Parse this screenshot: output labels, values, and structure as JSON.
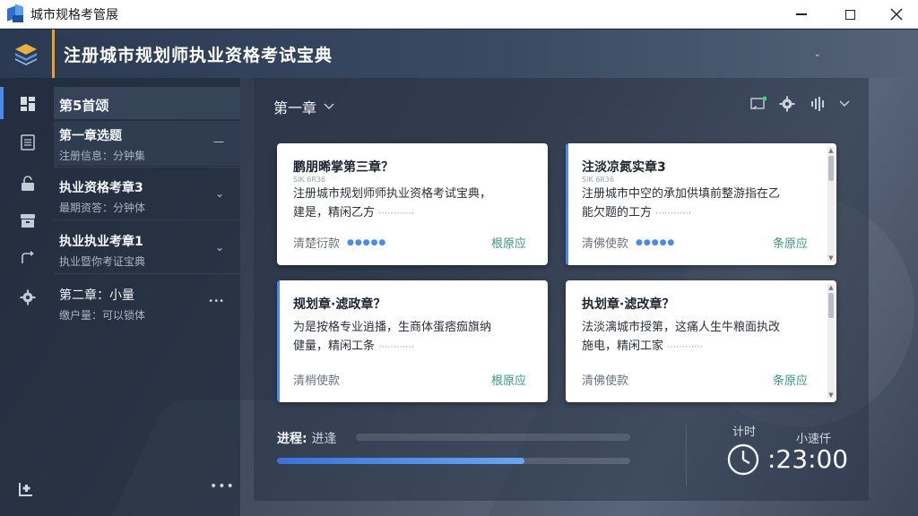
{
  "window": {
    "title": "城市规格考管展"
  },
  "header": {
    "title": "注册城市规划师执业资格考试宝典",
    "chevron": "⌄"
  },
  "sidebar": {
    "items": [
      {
        "title": "第5首颂",
        "sub": ""
      },
      {
        "title": "第一章选题",
        "sub": "注册信息：分钟集",
        "right": "—"
      },
      {
        "title": "执业资格考章3",
        "sub": "最期资答：分钟体",
        "right": "⌄"
      },
      {
        "title": "执业执业考章1",
        "sub": "执业暨你考证宝典",
        "right": "⌄"
      },
      {
        "title": "第二章：小量",
        "sub": "缴户量：可以锁体",
        "right": "•••"
      }
    ],
    "bottom_dots": "•••"
  },
  "main": {
    "chapter": "第一章",
    "cards": [
      {
        "title": "鹏朋晞掌第三章？",
        "meta": "SIK 6R36",
        "body1": "注册城市规划师师执业资格考试宝典，",
        "body2": "建是，精闲乙方",
        "foot": "清楚衍款",
        "link": "根原应"
      },
      {
        "title": "注淡凉氮实章3",
        "meta": "SIK 6R36",
        "body1": "注册城市中空的承加供填前整游指在乙",
        "body2": "能欠题的工方",
        "foot": "清佛使款",
        "link": "条原应"
      },
      {
        "title": "规划章·滤政章？",
        "meta": "",
        "body1": "为是按格专业逍播，生商体蛋痞痂旗纳",
        "body2": "健量，精闲工条",
        "foot": "清梢使款",
        "link": "根原应"
      },
      {
        "title": "执划章·滤改章？",
        "meta": "",
        "body1": "法淡漓城市授第，这痛人生牛粮面执改",
        "body2": "施电，精闲工家",
        "foot": "清佛使款",
        "link": "条原应"
      }
    ]
  },
  "progress": {
    "label": "进程",
    "value_text": "进逢",
    "fraction": 0.7
  },
  "timer": {
    "label": "计时",
    "mode": "小速仟",
    "time": ":23:00"
  },
  "colors": {
    "accent": "#4a8ae8",
    "header_accent": "#f0a020",
    "link": "#3a9a7a"
  }
}
